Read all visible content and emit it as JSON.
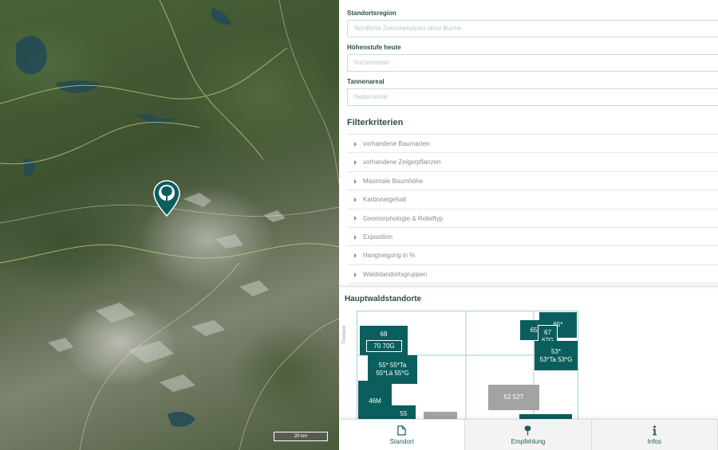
{
  "map": {
    "scale_label": "20 km",
    "marker_icon": "tree-pin-icon",
    "marker_color": "#0b5e5e"
  },
  "form": {
    "region_label": "Standortsregion",
    "region_value": "Nördliche Zwischenalpen ohne Buche",
    "altitude_label": "Höhenstufe heute",
    "altitude_value": "hochmontan",
    "fir_label": "Tannenareal",
    "fir_value": "Nebenareal"
  },
  "filters": {
    "title": "Filterkriterien",
    "items": [
      "vorhandene Baumarten",
      "vorhandene Zeigerpflanzen",
      "Maximale Baumhöhe",
      "Karbonatgehalt",
      "Geomorphologie & Relieftyp",
      "Exposition",
      "Hangneigung in %",
      "Waldstandortsgruppen"
    ]
  },
  "hauptwald": {
    "title": "Hauptwaldstandorte",
    "y_label": "Trocken",
    "boxes": {
      "b68": "68",
      "b7070g": "70 70G",
      "b55": "55* 55*Ta\n55*Lä 55*G",
      "b46m": "46M",
      "b55b": "55",
      "b5252t": "52 52T",
      "b65": "65",
      "b65s": "65*",
      "b67": "67\n67G",
      "b53": "53*\n53*Ta 53*G"
    }
  },
  "nav": {
    "tabs": [
      {
        "label": "Standort",
        "icon": "document-icon",
        "active": true
      },
      {
        "label": "Empfehlung",
        "icon": "tree-icon",
        "active": false
      },
      {
        "label": "Infos",
        "icon": "info-icon",
        "active": false
      }
    ]
  },
  "colors": {
    "accent": "#0b5e5e",
    "grey_box": "#a3a3a3"
  }
}
